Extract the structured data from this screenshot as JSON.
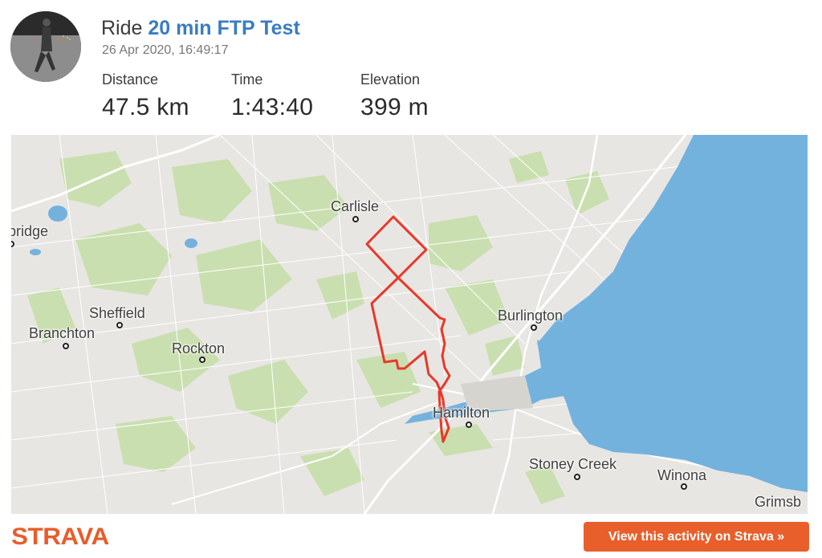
{
  "header": {
    "activity_type": "Ride",
    "activity_name": "20 min FTP Test",
    "timestamp": "26 Apr 2020, 16:49:17"
  },
  "stats": [
    {
      "label": "Distance",
      "value": "47.5 km"
    },
    {
      "label": "Time",
      "value": "1:43:40"
    },
    {
      "label": "Elevation",
      "value": "399 m"
    }
  ],
  "map": {
    "places": [
      {
        "name": "Carlisle"
      },
      {
        "name": "bridge"
      },
      {
        "name": "Sheffield"
      },
      {
        "name": "Branchton"
      },
      {
        "name": "Rockton"
      },
      {
        "name": "Burlington"
      },
      {
        "name": "Hamilton"
      },
      {
        "name": "Stoney Creek"
      },
      {
        "name": "Winona"
      },
      {
        "name": "Grimsb"
      }
    ],
    "route_color": "#e8382a",
    "water_color": "#74b2de",
    "park_color": "#c9dfaa",
    "land_color": "#e8e6e3"
  },
  "footer": {
    "logo_text": "STRAVA",
    "view_button_label": "View this activity on Strava »",
    "brand_color": "#e85f2b"
  }
}
